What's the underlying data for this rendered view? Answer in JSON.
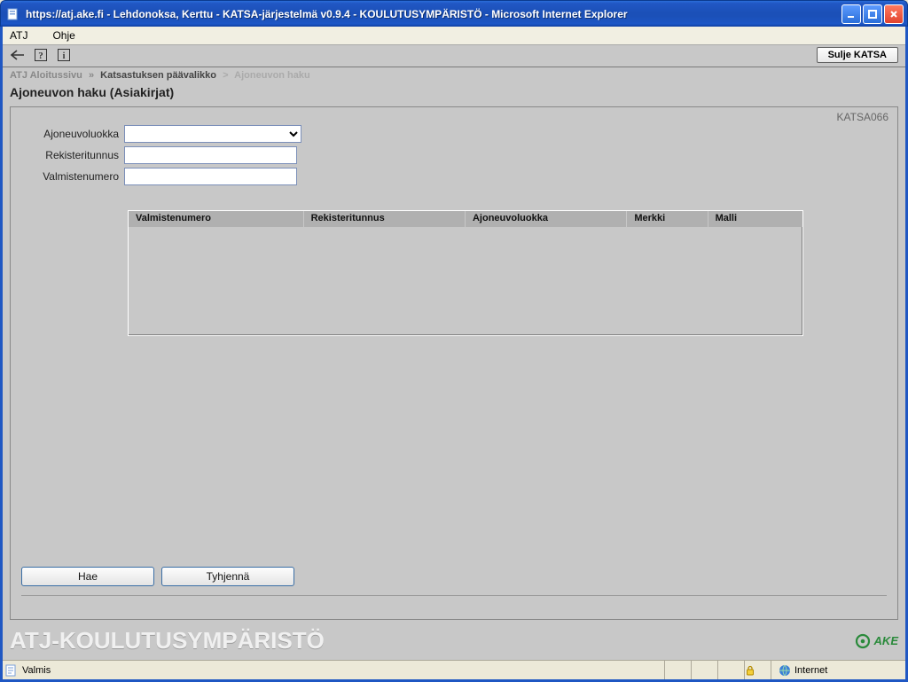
{
  "window": {
    "title": "https://atj.ake.fi - Lehdonoksa, Kerttu - KATSA-järjestelmä v0.9.4 - KOULUTUSYMPÄRISTÖ - Microsoft Internet Explorer"
  },
  "menubar": {
    "items": [
      "ATJ",
      "Ohje"
    ]
  },
  "toolbar": {
    "close_btn": "Sulje KATSA"
  },
  "breadcrumb": {
    "items": [
      {
        "label": "ATJ Aloitussivu"
      },
      {
        "label": "Katsastuksen päävalikko"
      },
      {
        "label": "Ajoneuvon haku"
      }
    ],
    "sep": "»"
  },
  "page": {
    "title": "Ajoneuvon haku (Asiakirjat)",
    "panel_code": "KATSA066"
  },
  "form": {
    "ajoneuvoluokka_label": "Ajoneuvoluokka",
    "rekisteritunnus_label": "Rekisteritunnus",
    "valmistenumero_label": "Valmistenumero",
    "ajoneuvoluokka_value": "",
    "rekisteritunnus_value": "",
    "valmistenumero_value": ""
  },
  "results": {
    "columns": [
      "Valmistenumero",
      "Rekisteritunnus",
      "Ajoneuvoluokka",
      "Merkki",
      "Malli"
    ]
  },
  "buttons": {
    "hae": "Hae",
    "tyhjenna": "Tyhjennä"
  },
  "footer": {
    "brand": "ATJ-KOULUTUSYMPÄRISTÖ",
    "logo_text": "AKE"
  },
  "statusbar": {
    "status": "Valmis",
    "zone": "Internet"
  }
}
